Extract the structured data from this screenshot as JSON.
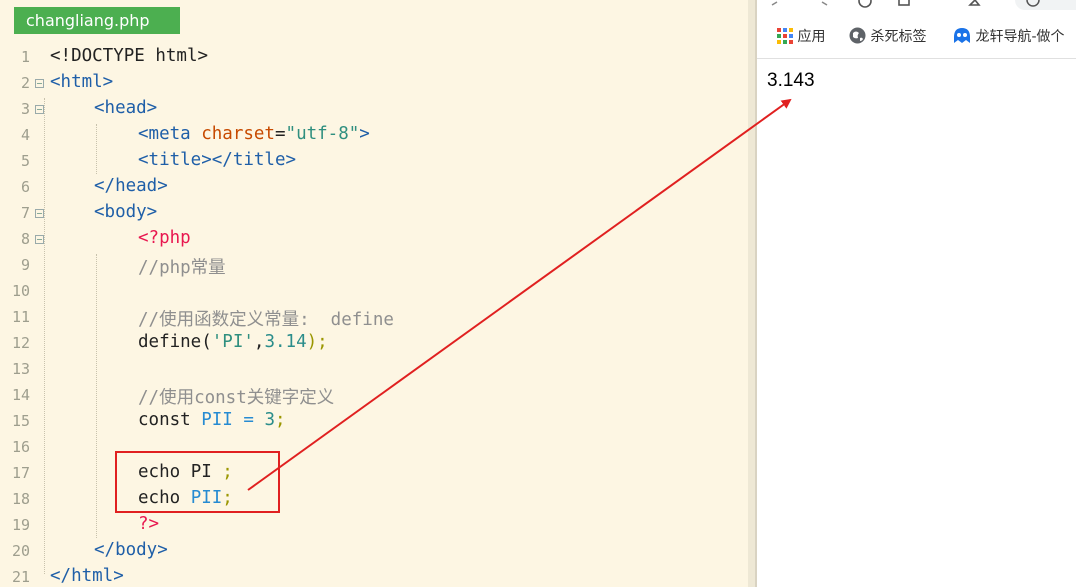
{
  "editor": {
    "tab_label": "changliang.php",
    "line_numbers": [
      "1",
      "2",
      "3",
      "4",
      "5",
      "6",
      "7",
      "8",
      "9",
      "10",
      "11",
      "12",
      "13",
      "14",
      "15",
      "16",
      "17",
      "18",
      "19",
      "20",
      "21"
    ]
  },
  "code": {
    "l1": "<!DOCTYPE html>",
    "l2_tag": "<html>",
    "l3_tag": "<head>",
    "l4_open": "<meta ",
    "l4_attr": "charset",
    "l4_eq": "=",
    "l4_val": "\"utf-8\"",
    "l4_close": ">",
    "l5": "<title></title>",
    "l6": "</head>",
    "l7": "<body>",
    "l8": "<?php",
    "l9": "//php常量",
    "l11": "//使用函数定义常量:  define",
    "l12_fn": "define(",
    "l12_str": "'PI'",
    "l12_comma": ",",
    "l12_num": "3.14",
    "l12_end": ");",
    "l14": "//使用const关键字定义",
    "l15_kw": "const ",
    "l15_name": "PII",
    "l15_eq": " = ",
    "l15_num": "3",
    "l15_semi": ";",
    "l17_kw": "echo ",
    "l17_name": "PI",
    "l17_semi": " ;",
    "l18_kw": "echo ",
    "l18_name": "PII",
    "l18_semi": ";",
    "l19": "?>",
    "l20": "</body>",
    "l21": "</html>"
  },
  "browser": {
    "bookmarks": [
      {
        "label": "应用",
        "icon": "apps-grid-icon"
      },
      {
        "label": "杀死标签",
        "icon": "globe-icon"
      },
      {
        "label": "龙轩导航-做个",
        "icon": "longxuan-logo-icon"
      }
    ],
    "output_text": "3.143"
  },
  "colors": {
    "tab_bg": "#4caf50",
    "annotation": "#e02020",
    "editor_bg": "#fdf6e3"
  }
}
